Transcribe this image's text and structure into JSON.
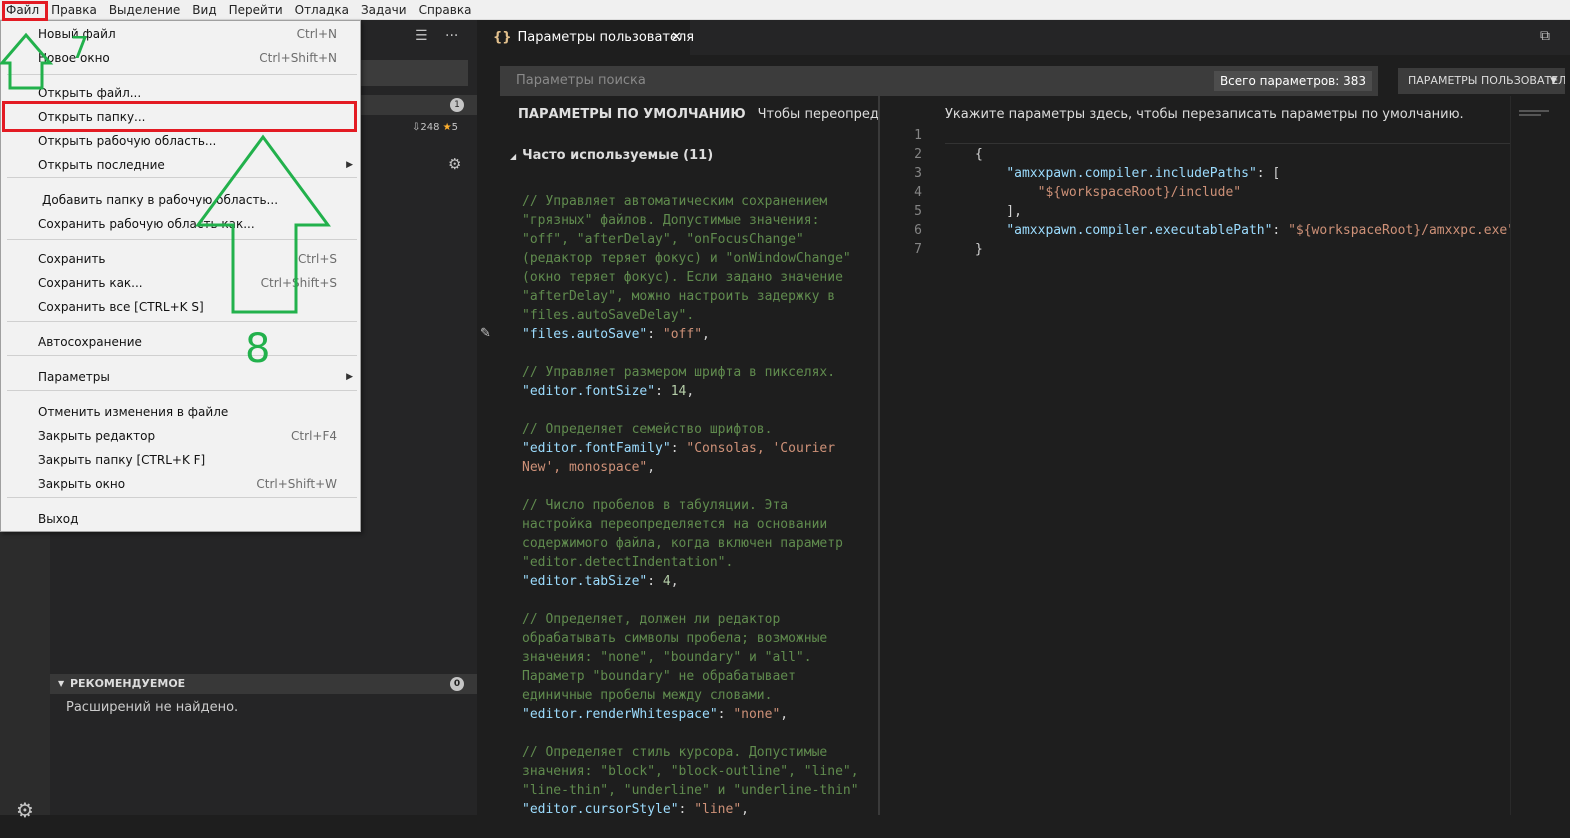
{
  "menubar": [
    "Файл",
    "Правка",
    "Выделение",
    "Вид",
    "Перейти",
    "Отладка",
    "Задачи",
    "Справка"
  ],
  "file_menu": {
    "items": [
      {
        "label": "Новый файл",
        "shortcut": "Ctrl+N"
      },
      {
        "label": "Новое окно",
        "shortcut": "Ctrl+Shift+N"
      },
      {
        "label": "Открыть файл...",
        "shortcut": ""
      },
      {
        "label": "Открыть папку...",
        "shortcut": ""
      },
      {
        "label": "Открыть рабочую область...",
        "shortcut": ""
      },
      {
        "label": "Открыть последние",
        "shortcut": ""
      },
      {
        "label": "Добавить папку в рабочую область...",
        "shortcut": ""
      },
      {
        "label": "Сохранить рабочую область как...",
        "shortcut": ""
      },
      {
        "label": "Сохранить",
        "shortcut": "Ctrl+S"
      },
      {
        "label": "Сохранить как...",
        "shortcut": "Ctrl+Shift+S"
      },
      {
        "label": "Сохранить все [CTRL+K S]",
        "shortcut": ""
      },
      {
        "label": "Автосохранение",
        "shortcut": ""
      },
      {
        "label": "Параметры",
        "shortcut": ""
      },
      {
        "label": "Отменить изменения в файле",
        "shortcut": ""
      },
      {
        "label": "Закрыть редактор",
        "shortcut": "Ctrl+F4"
      },
      {
        "label": "Закрыть папку [CTRL+K F]",
        "shortcut": ""
      },
      {
        "label": "Закрыть окно",
        "shortcut": "Ctrl+Shift+W"
      },
      {
        "label": "Выход",
        "shortcut": ""
      }
    ]
  },
  "annotations": {
    "step7": "7",
    "step8": "8",
    "highlight_color": "#e31b23",
    "arrow_color": "#22b14c"
  },
  "sidebar": {
    "section1_badge": "1",
    "item_downloads": "248",
    "item_rating": "5",
    "recommended_title": "РЕКОМЕНДУЕМОЕ",
    "recommended_badge": "0",
    "recommended_empty": "Расширений не найдено."
  },
  "editor": {
    "tab_icon": "{}",
    "tab_title": "Параметры пользователя",
    "search_placeholder": "Параметры поиска",
    "total_count": "Всего параметров: 383",
    "scope_button": "ПАРАМЕТРЫ ПОЛЬЗОВАТЕЛЯ",
    "defaults_title": "ПАРАМЕТРЫ ПО УМОЛЧАНИЮ",
    "defaults_hint": "Чтобы переопределить",
    "group_title": "Часто используемые (11)",
    "right_hint": "Укажите параметры здесь, чтобы перезаписать параметры по умолчанию."
  },
  "default_settings": [
    {
      "comment": [
        "// Управляет автоматическим сохранением",
        "\"грязных\" файлов. Допустимые значения:",
        "\"off\", \"afterDelay\", \"onFocusChange\"",
        "(редактор теряет фокус) и \"onWindowChange\"",
        "(окно теряет фокус). Если задано значение",
        "\"afterDelay\", можно настроить задержку в",
        "\"files.autoSaveDelay\"."
      ],
      "key": "\"files.autoSave\"",
      "value": [
        "\"off\""
      ],
      "num": false
    },
    {
      "comment": [
        "// Управляет размером шрифта в пикселях."
      ],
      "key": "\"editor.fontSize\"",
      "value": [
        "14"
      ],
      "num": true
    },
    {
      "comment": [
        "// Определяет семейство шрифтов."
      ],
      "key": "\"editor.fontFamily\"",
      "value": [
        "\"Consolas, 'Courier",
        "New', monospace\""
      ],
      "num": false
    },
    {
      "comment": [
        "// Число пробелов в табуляции. Эта",
        "настройка переопределяется на основании",
        "содержимого файла, когда включен параметр",
        "\"editor.detectIndentation\"."
      ],
      "key": "\"editor.tabSize\"",
      "value": [
        "4"
      ],
      "num": true
    },
    {
      "comment": [
        "// Определяет, должен ли редактор",
        "обрабатывать символы пробела; возможные",
        "значения: \"none\", \"boundary\" и \"all\".",
        "Параметр \"boundary\" не обрабатывает",
        "единичные пробелы между словами."
      ],
      "key": "\"editor.renderWhitespace\"",
      "value": [
        "\"none\""
      ],
      "num": false
    },
    {
      "comment": [
        "// Определяет стиль курсора. Допустимые",
        "значения: \"block\", \"block-outline\", \"line\",",
        "\"line-thin\", \"underline\" и \"underline-thin\""
      ],
      "key": "\"editor.cursorStyle\"",
      "value": [
        "\"line\""
      ],
      "num": false
    }
  ],
  "user_settings": [
    {
      "n": "1",
      "text": ""
    },
    {
      "n": "2",
      "text": "{"
    },
    {
      "n": "3",
      "key": "\"amxxpawn.compiler.includePaths\"",
      "tail": ": [",
      "indent": "    "
    },
    {
      "n": "4",
      "str": "\"${workspaceRoot}/include\"",
      "indent": "        "
    },
    {
      "n": "5",
      "text": "    ],"
    },
    {
      "n": "6",
      "key": "\"amxxpawn.compiler.executablePath\"",
      "tail": ": ",
      "str": "\"${workspaceRoot}/amxxpc.exe\"",
      "indent": "    "
    },
    {
      "n": "7",
      "text": "}"
    }
  ]
}
